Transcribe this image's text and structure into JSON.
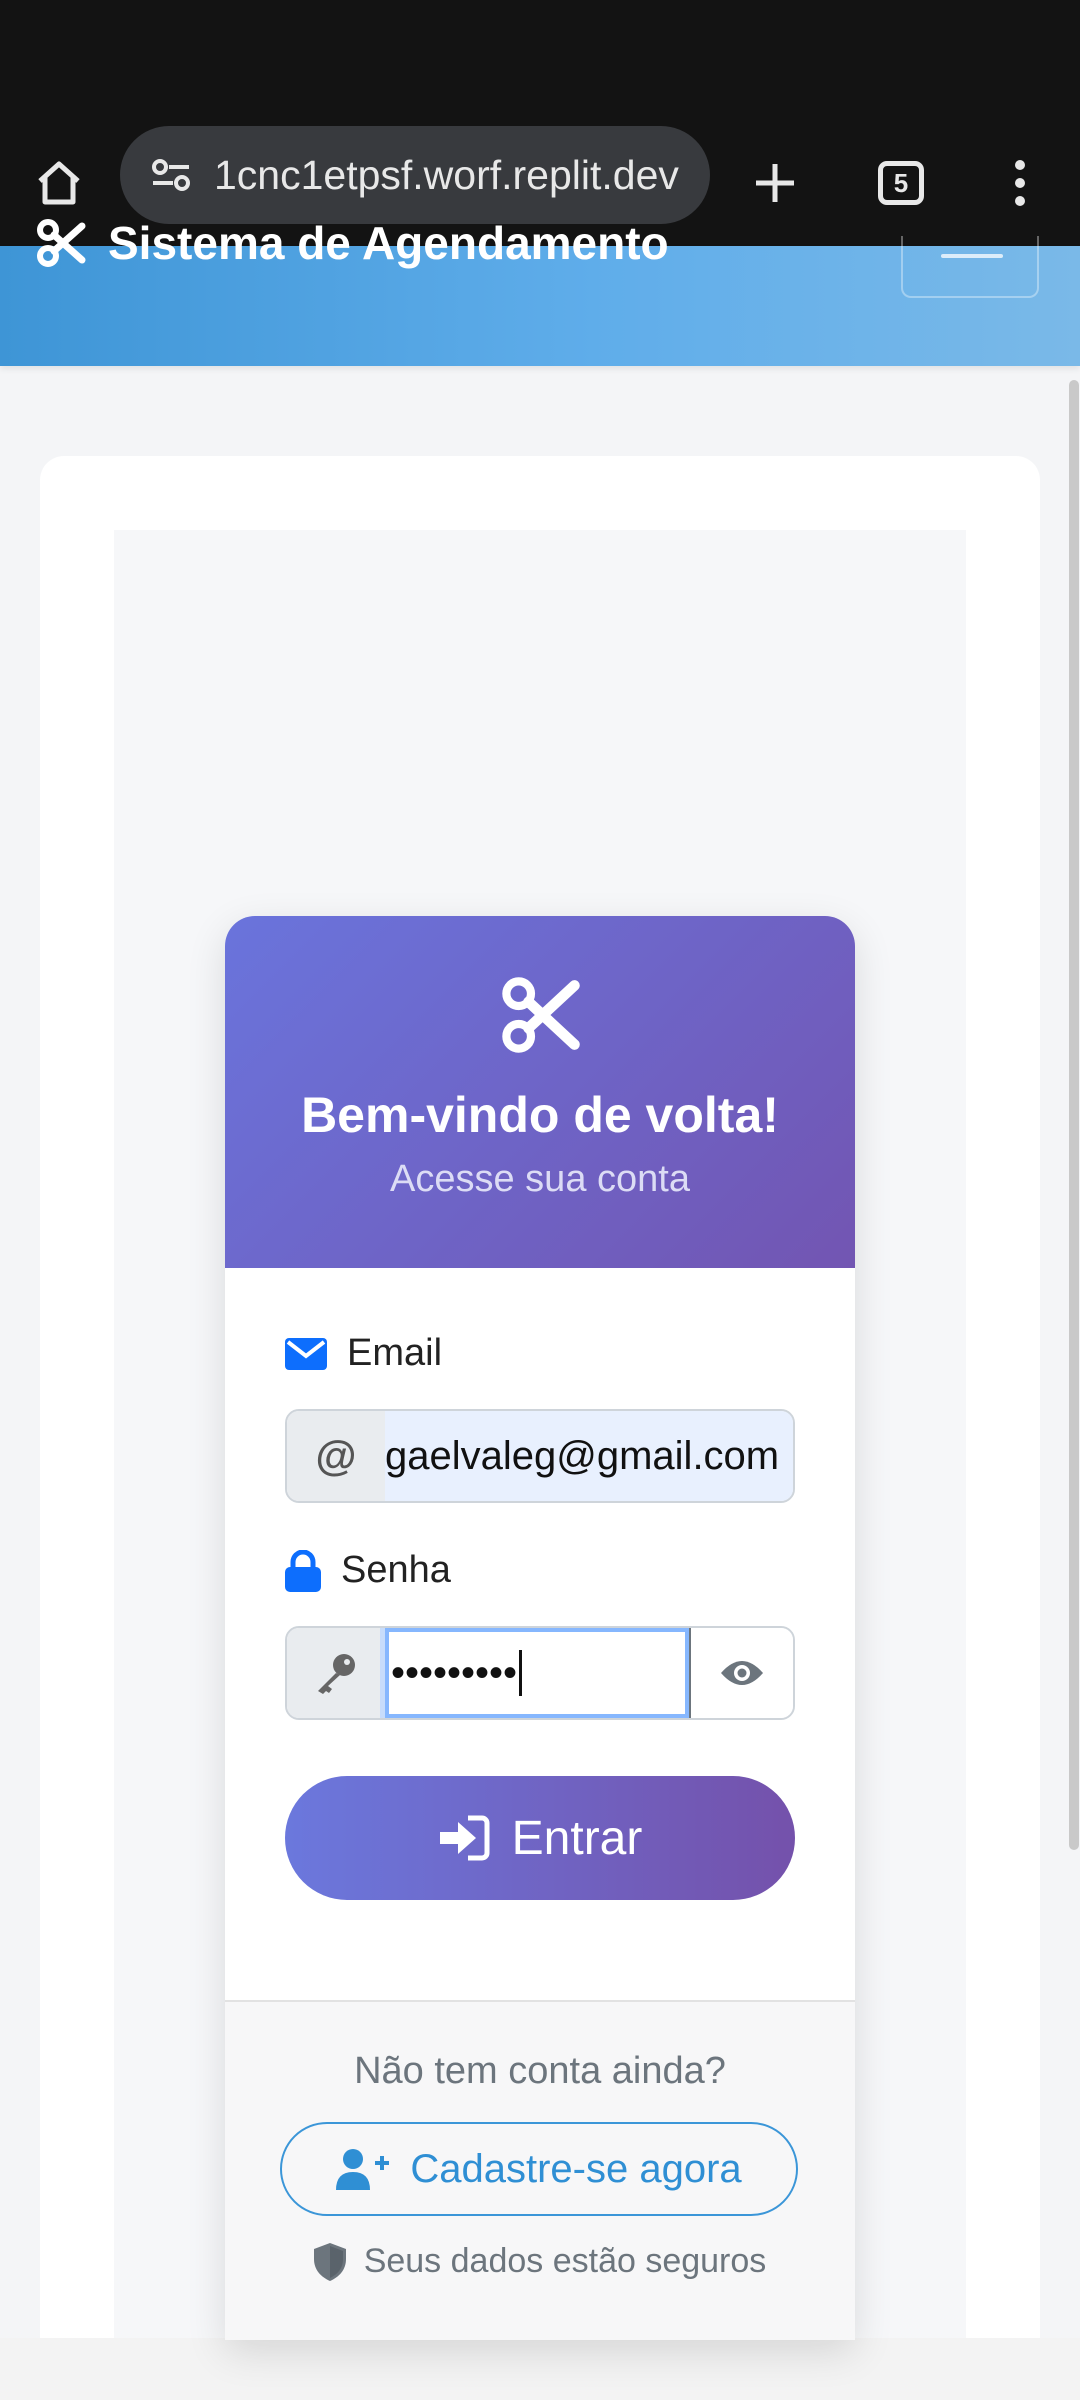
{
  "browser": {
    "url": "1cnc1etpsf.worf.replit.dev",
    "tab_count": "5"
  },
  "app": {
    "brand_title": "Sistema de Agendamento"
  },
  "login": {
    "title": "Bem-vindo de volta!",
    "subtitle": "Acesse sua conta",
    "email_label": "Email",
    "email_addon": "@",
    "email_value": "gaelvaleg@gmail.com",
    "password_label": "Senha",
    "password_value": "•••••••••",
    "submit_label": "Entrar"
  },
  "footer": {
    "no_account_text": "Não tem conta ainda?",
    "register_label": "Cadastre-se agora",
    "secure_text": "Seus dados estão seguros"
  },
  "icons": {
    "brand": "scissors-icon",
    "email": "envelope-icon",
    "password": "lock-icon",
    "key": "key-icon",
    "toggle_password": "eye-icon",
    "submit": "sign-in-icon",
    "register": "user-plus-icon",
    "secure": "shield-icon"
  },
  "colors": {
    "header_gradient_start": "#3e95d6",
    "card_gradient_start": "#6a74dc",
    "card_gradient_end": "#7255b2",
    "accent_blue": "#0d6efd",
    "register_blue": "#2f8fd4"
  }
}
